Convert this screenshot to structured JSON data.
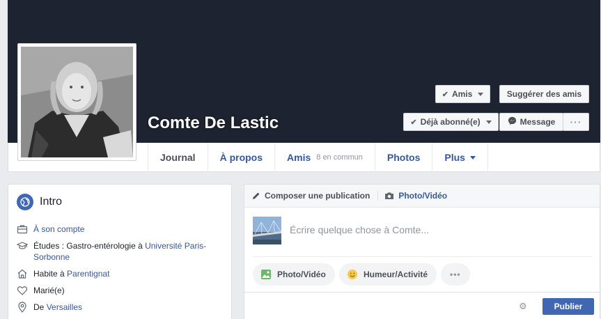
{
  "profile": {
    "name": "Comte De Lastic"
  },
  "actions": {
    "friends": "Amis",
    "suggest_friends": "Suggérer des amis",
    "following": "Déjà abonné(e)",
    "message": "Message",
    "more": "···"
  },
  "tabs": [
    {
      "label": "Journal",
      "active": true
    },
    {
      "label": "À propos"
    },
    {
      "label": "Amis",
      "sub": "8 en commun"
    },
    {
      "label": "Photos"
    },
    {
      "label": "Plus"
    }
  ],
  "intro": {
    "title": "Intro",
    "items": [
      {
        "icon": "briefcase-icon",
        "link": "À son compte"
      },
      {
        "icon": "graduation-cap-icon",
        "prefix": "Études : Gastro-entérologie à ",
        "link": "Université Paris-Sorbonne"
      },
      {
        "icon": "home-icon",
        "prefix": "Habite à ",
        "link": "Parentignat"
      },
      {
        "icon": "heart-icon",
        "prefix": "Marié(e)"
      },
      {
        "icon": "location-pin-icon",
        "prefix": "De ",
        "link": "Versailles"
      }
    ]
  },
  "composer": {
    "compose_tab": "Composer une publication",
    "photo_tab": "Photo/Vidéo",
    "placeholder": "Écrire quelque chose à Comte...",
    "photo_button": "Photo/Vidéo",
    "mood_button": "Humeur/Activité",
    "more_button": "•••",
    "publish": "Publier"
  },
  "colors": {
    "cover": "#1d2330",
    "link": "#365899",
    "primary": "#4267b2"
  }
}
